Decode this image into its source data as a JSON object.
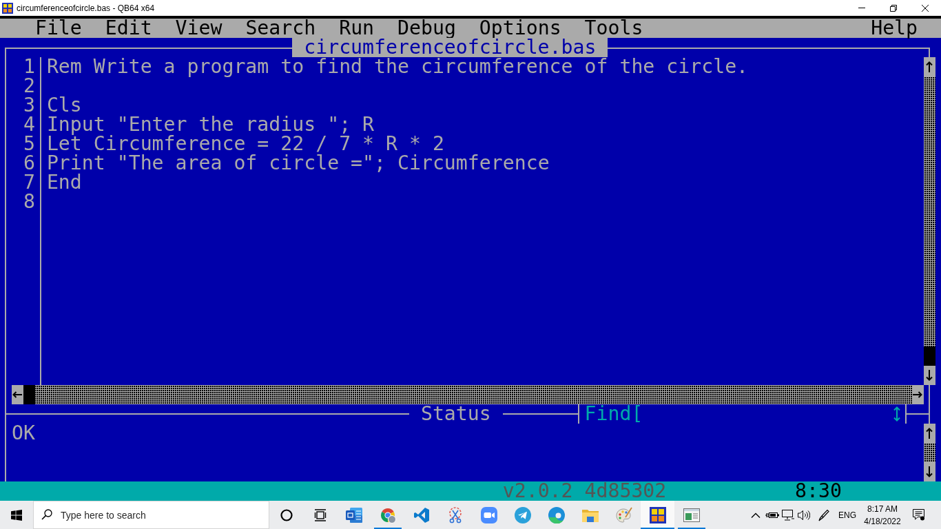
{
  "window": {
    "title": "circumferenceofcircle.bas - QB64 x64"
  },
  "menu": [
    "File",
    "Edit",
    "View",
    "Search",
    "Run",
    "Debug",
    "Options",
    "Tools",
    "Help"
  ],
  "editor": {
    "title": "circumferenceofcircle.bas",
    "lines": [
      {
        "number": "1",
        "text": "Rem Write a program to find the circumference of the circle."
      },
      {
        "number": "2"
      },
      {
        "number": "3",
        "text": "Cls"
      },
      {
        "number": "4",
        "text": "Input \"Enter the radius \"; R"
      },
      {
        "number": "5",
        "text": "Let Circumference = 22 / 7 * R * 2"
      },
      {
        "number": "6",
        "text": "Print \"The area of circle =\"; Circumference"
      },
      {
        "number": "7",
        "text": "End"
      },
      {
        "number": "8"
      }
    ]
  },
  "status_panel": {
    "title": "Status",
    "message": "OK"
  },
  "find": {
    "label": "Find["
  },
  "status_bar": {
    "version": "v2.0.2 4d85302",
    "position": "8:30"
  },
  "taskbar": {
    "search": {
      "placeholder": "Type here to search"
    },
    "apps": [
      {
        "kind": "document",
        "running": false,
        "selected": false
      },
      {
        "kind": "round-logo",
        "running": true,
        "selected": false
      },
      {
        "kind": "code-editor",
        "running": false,
        "selected": false
      },
      {
        "kind": "scissors",
        "running": false,
        "selected": false
      },
      {
        "kind": "video-camera",
        "running": false,
        "selected": false
      },
      {
        "kind": "paper-plane",
        "running": false,
        "selected": false
      },
      {
        "kind": "wave-logo",
        "running": false,
        "selected": false
      },
      {
        "kind": "folder",
        "running": false,
        "selected": false
      },
      {
        "kind": "palette",
        "running": false,
        "selected": false
      },
      {
        "kind": "pixel-logo",
        "running": true,
        "selected": true
      },
      {
        "kind": "window",
        "running": true,
        "selected": false
      }
    ],
    "tray": {
      "language": "ENG",
      "time": "8:17 AM",
      "date": "4/18/2022"
    }
  }
}
